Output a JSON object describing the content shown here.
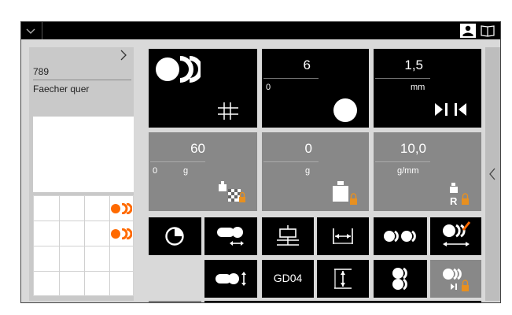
{
  "program": {
    "number": "789",
    "name": "Faecher quer"
  },
  "tiles": {
    "tile2": {
      "value": "6",
      "sub": "0"
    },
    "tile3": {
      "value": "1,5",
      "unit": "mm"
    },
    "tile4": {
      "value": "60",
      "sub": "0",
      "unit": "g"
    },
    "tile5": {
      "value": "0",
      "unit": "g"
    },
    "tile6": {
      "value": "10,0",
      "unit": "g/mm"
    }
  },
  "buttons": {
    "gd04_label": "GD04"
  },
  "icons": {
    "menu": "chevron-down-icon",
    "user": "user-icon",
    "manual": "book-icon",
    "expand_left": "chevron-right-icon",
    "collapse_right": "chevron-left-icon"
  },
  "colors": {
    "accent": "#ff6a00",
    "tile_dark": "#000000",
    "tile_gray": "#888888",
    "lock": "#e89020"
  }
}
